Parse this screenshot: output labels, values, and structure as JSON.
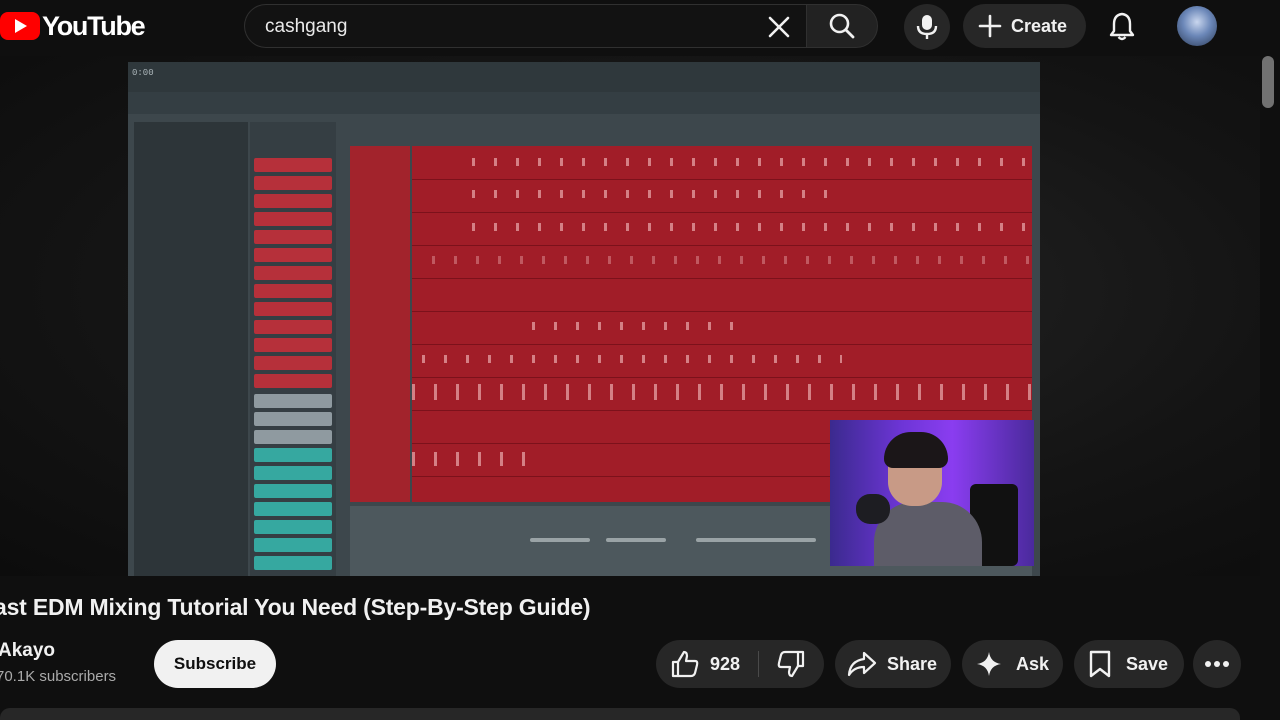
{
  "header": {
    "logo_text": "YouTube",
    "search_value": "cashgang",
    "create_label": "Create"
  },
  "video": {
    "daw_time": "0:00",
    "title": "ast EDM Mixing Tutorial You Need (Step-By-Step Guide)",
    "channel_name": "Akayo",
    "subscribers": "70.1K subscribers",
    "subscribe_label": "Subscribe",
    "like_count": "928",
    "share_label": "Share",
    "ask_label": "Ask",
    "save_label": "Save"
  },
  "colors": {
    "background": "#0f0f0f",
    "pill": "#272727",
    "youtube_red": "#ff0000",
    "playlist_red": "#a11d28",
    "subscribe_bg": "#f1f1f1"
  },
  "icons": [
    "youtube-logo-icon",
    "close-icon",
    "search-icon",
    "microphone-icon",
    "plus-icon",
    "bell-icon",
    "thumbs-up-icon",
    "thumbs-down-icon",
    "share-arrow-icon",
    "sparkle-icon",
    "bookmark-icon",
    "more-horizontal-icon"
  ]
}
